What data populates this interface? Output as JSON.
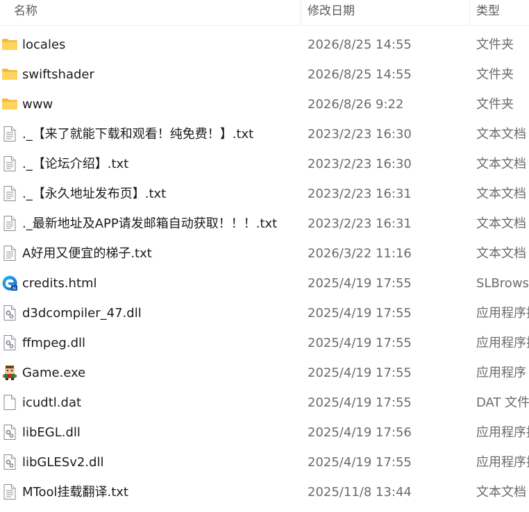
{
  "header": {
    "name": "名称",
    "date": "修改日期",
    "type": "类型"
  },
  "files": [
    {
      "name": "locales",
      "date": "2026/8/25 14:55",
      "type": "文件夹",
      "icon": "folder-icon"
    },
    {
      "name": "swiftshader",
      "date": "2026/8/25 14:55",
      "type": "文件夹",
      "icon": "folder-icon"
    },
    {
      "name": "www",
      "date": "2026/8/26 9:22",
      "type": "文件夹",
      "icon": "folder-icon"
    },
    {
      "name": "._【来了就能下载和观看！纯免费！】.txt",
      "date": "2023/2/23 16:30",
      "type": "文本文档",
      "icon": "text-file-icon"
    },
    {
      "name": "._【论坛介绍】.txt",
      "date": "2023/2/23 16:30",
      "type": "文本文档",
      "icon": "text-file-icon"
    },
    {
      "name": "._【永久地址发布页】.txt",
      "date": "2023/2/23 16:31",
      "type": "文本文档",
      "icon": "text-file-icon"
    },
    {
      "name": "._最新地址及APP请发邮箱自动获取！！！.txt",
      "date": "2023/2/23 16:31",
      "type": "文本文档",
      "icon": "text-file-icon"
    },
    {
      "name": "A好用又便宜的梯子.txt",
      "date": "2026/3/22 11:16",
      "type": "文本文档",
      "icon": "text-file-icon"
    },
    {
      "name": "credits.html",
      "date": "2025/4/19 17:55",
      "type": "SLBrowser",
      "icon": "browser-icon"
    },
    {
      "name": "d3dcompiler_47.dll",
      "date": "2025/4/19 17:55",
      "type": "应用程序扩展",
      "icon": "dll-file-icon"
    },
    {
      "name": "ffmpeg.dll",
      "date": "2025/4/19 17:55",
      "type": "应用程序扩展",
      "icon": "dll-file-icon"
    },
    {
      "name": "Game.exe",
      "date": "2025/4/19 17:55",
      "type": "应用程序",
      "icon": "game-exe-icon"
    },
    {
      "name": "icudtl.dat",
      "date": "2025/4/19 17:55",
      "type": "DAT 文件",
      "icon": "blank-file-icon"
    },
    {
      "name": "libEGL.dll",
      "date": "2025/4/19 17:56",
      "type": "应用程序扩展",
      "icon": "dll-file-icon"
    },
    {
      "name": "libGLESv2.dll",
      "date": "2025/4/19 17:55",
      "type": "应用程序扩展",
      "icon": "dll-file-icon"
    },
    {
      "name": "MTool挂载翻译.txt",
      "date": "2025/11/8 13:44",
      "type": "文本文档",
      "icon": "text-file-icon"
    }
  ],
  "colors": {
    "folder": "#f5c24c",
    "date_text": "#6b6b6b"
  }
}
